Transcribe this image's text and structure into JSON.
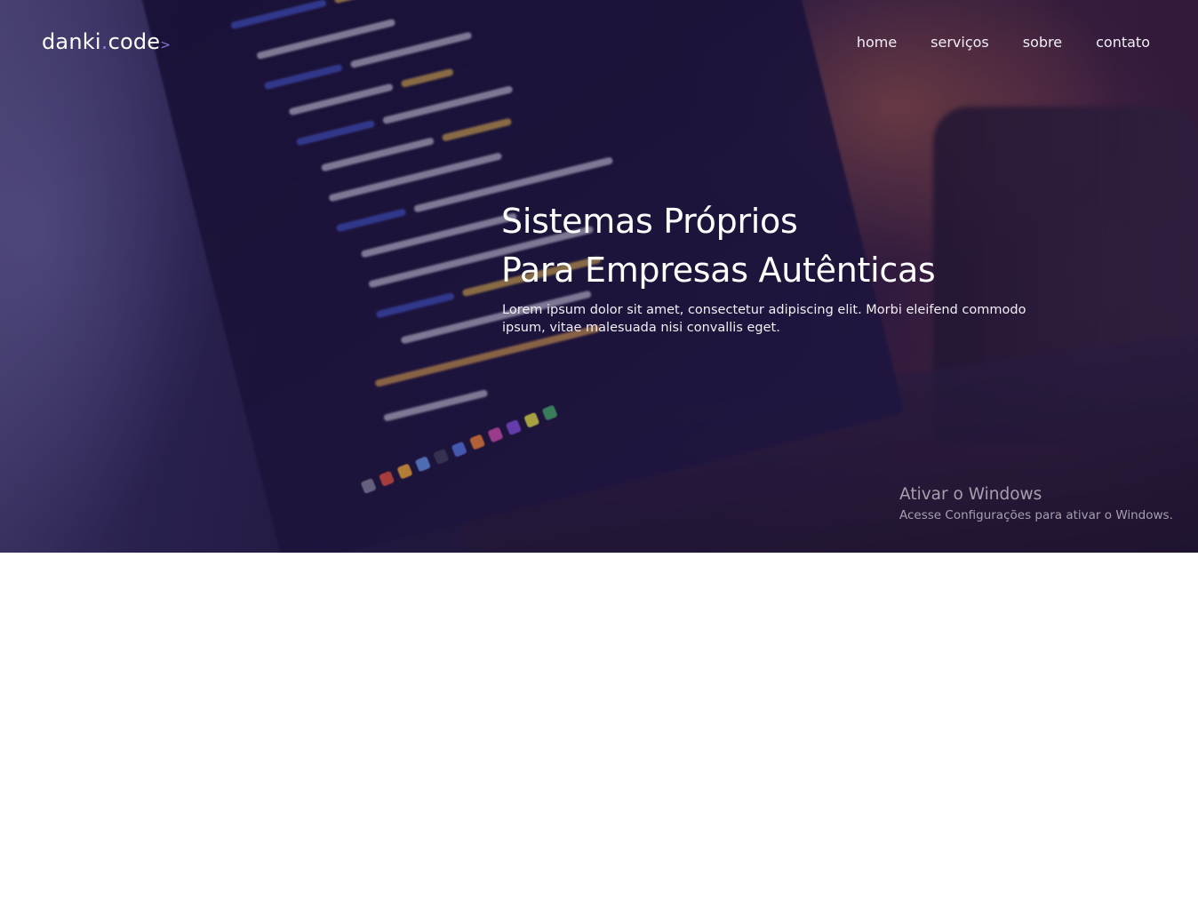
{
  "brand": {
    "name_part1": "danki",
    "dot": ".",
    "name_part2": "code",
    "arrow": ">"
  },
  "nav": {
    "items": [
      {
        "label": "home"
      },
      {
        "label": "serviços"
      },
      {
        "label": "sobre"
      },
      {
        "label": "contato"
      }
    ]
  },
  "hero": {
    "title_line1": "Sistemas Próprios",
    "title_line2": "Para Empresas Autênticas",
    "description": "Lorem ipsum dolor sit amet, consectetur adipiscing elit. Morbi eleifend commodo ipsum, vitae malesuada nisi convallis eget."
  },
  "windows_watermark": {
    "title": "Ativar o Windows",
    "subtitle": "Acesse Configurações para ativar o Windows."
  },
  "colors": {
    "accent": "#8a7bd6",
    "text": "#ffffff",
    "page_background": "#ffffff",
    "hero_tint": "#2b1a3f"
  }
}
